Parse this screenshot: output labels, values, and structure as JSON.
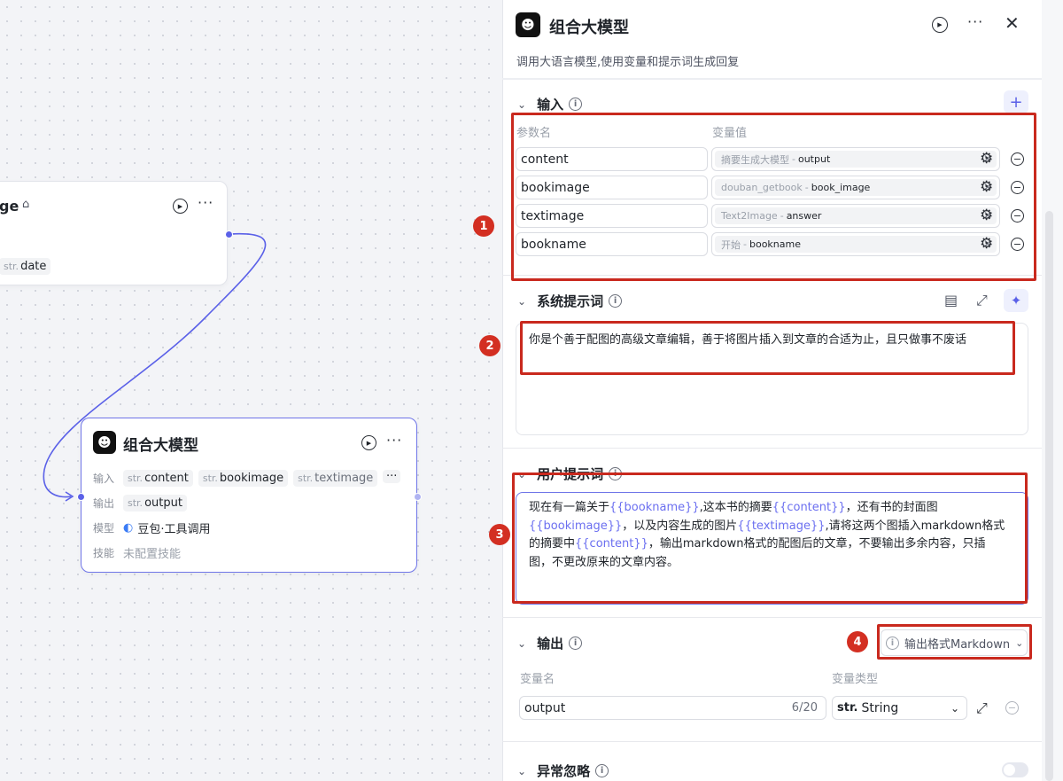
{
  "canvas": {
    "top_node": {
      "title_fragment": "ge",
      "output_tag": {
        "prefix": "str.",
        "name": "date"
      }
    },
    "main_node": {
      "title": "组合大模型",
      "rows": {
        "input_label": "输入",
        "inputs": [
          {
            "prefix": "str.",
            "name": "content"
          },
          {
            "prefix": "str.",
            "name": "bookimage"
          },
          {
            "prefix": "str.",
            "name": "textimage"
          }
        ],
        "output_label": "输出",
        "output": {
          "prefix": "str.",
          "name": "output"
        },
        "model_label": "模型",
        "model_value": "豆包·工具调用",
        "skill_label": "技能",
        "skill_value": "未配置技能"
      }
    }
  },
  "panel": {
    "title": "组合大模型",
    "subtitle": "调用大语言模型,使用变量和提示词生成回复",
    "input_section": {
      "title": "输入",
      "col_name": "参数名",
      "col_value": "变量值",
      "rows": [
        {
          "name": "content",
          "source": "摘要生成大模型",
          "sep": "-",
          "var": "output"
        },
        {
          "name": "bookimage",
          "source": "douban_getbook",
          "sep": "-",
          "var": "book_image"
        },
        {
          "name": "textimage",
          "source": "Text2Image",
          "sep": "-",
          "var": "answer"
        },
        {
          "name": "bookname",
          "source": "开始",
          "sep": "-",
          "var": "bookname"
        }
      ]
    },
    "system_prompt": {
      "title": "系统提示词",
      "text": "你是个善于配图的高级文章编辑，善于将图片插入到文章的合适为止，且只做事不废话"
    },
    "user_prompt": {
      "title": "用户提示词",
      "segments": [
        {
          "t": "现在有一篇关于",
          "tmpl": false
        },
        {
          "t": "{{bookname}}",
          "tmpl": true
        },
        {
          "t": ",这本书的摘要",
          "tmpl": false
        },
        {
          "t": "{{content}}",
          "tmpl": true
        },
        {
          "t": "，还有书的封面图",
          "tmpl": false
        },
        {
          "t": "{{bookimage}}",
          "tmpl": true
        },
        {
          "t": "，以及内容生成的图片",
          "tmpl": false
        },
        {
          "t": "{{textimage}}",
          "tmpl": true
        },
        {
          "t": ",请将这两个图插入markdown格式的摘要中",
          "tmpl": false
        },
        {
          "t": "{{content}}",
          "tmpl": true
        },
        {
          "t": "，输出markdown格式的配图后的文章，不要输出多余内容，只插图，不更改原来的文章内容。",
          "tmpl": false
        }
      ]
    },
    "output_section": {
      "title": "输出",
      "format_label": "输出格式Markdown",
      "col_name": "变量名",
      "col_type": "变量类型",
      "var_name": "output",
      "counter": "6/20",
      "type_prefix": "str.",
      "type_value": "String"
    },
    "error_section": {
      "title": "异常忽略"
    }
  },
  "markers": [
    "1",
    "2",
    "3",
    "4"
  ],
  "colors": {
    "accent": "#5b61e8",
    "annotation": "#c9291e",
    "template_var": "#6b6ff0"
  }
}
